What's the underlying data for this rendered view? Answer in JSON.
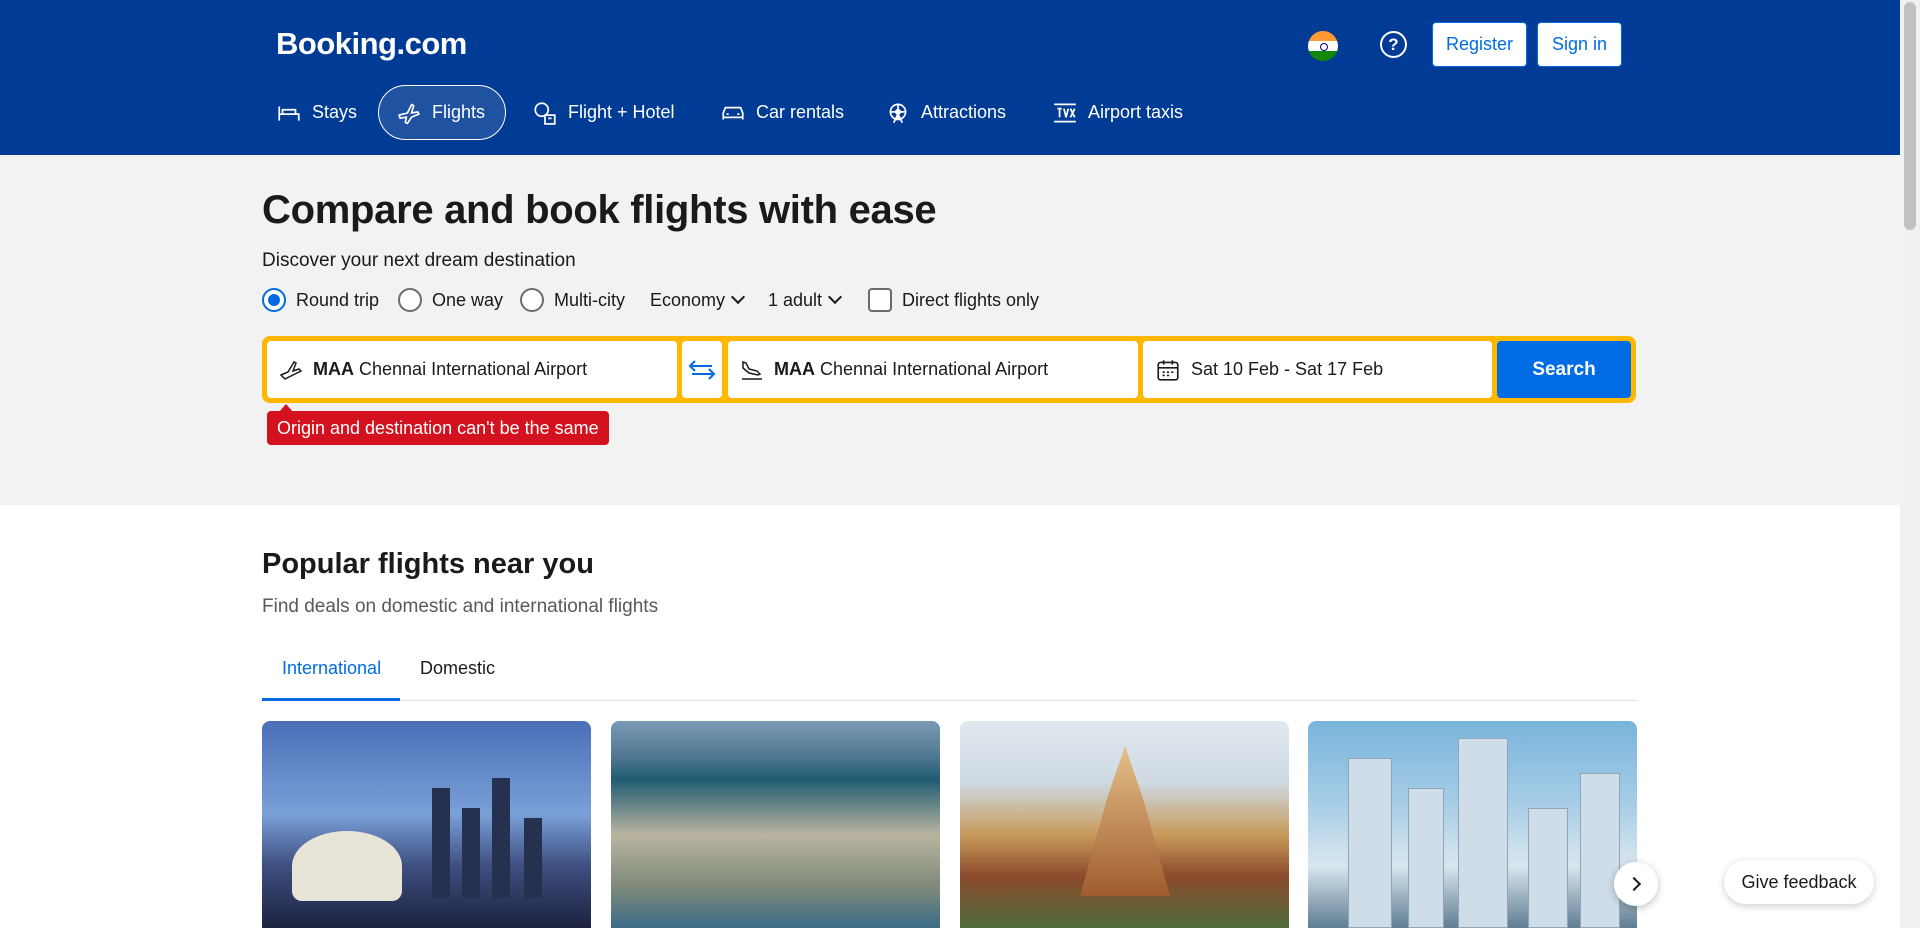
{
  "header": {
    "logo": "Booking.com",
    "register_label": "Register",
    "signin_label": "Sign in",
    "currency_flag": "india-flag-icon",
    "help_icon": "question-circle-icon"
  },
  "nav": {
    "items": [
      {
        "label": "Stays",
        "icon": "bed-icon"
      },
      {
        "label": "Flights",
        "icon": "plane-icon",
        "active": true
      },
      {
        "label": "Flight + Hotel",
        "icon": "plane-hotel-icon"
      },
      {
        "label": "Car rentals",
        "icon": "car-icon"
      },
      {
        "label": "Attractions",
        "icon": "ferris-wheel-icon"
      },
      {
        "label": "Airport taxis",
        "icon": "taxi-icon"
      }
    ]
  },
  "hero": {
    "title": "Compare and book flights with ease",
    "subtitle": "Discover your next dream destination",
    "trip_types": [
      "Round trip",
      "One way",
      "Multi-city"
    ],
    "selected_trip": "Round trip",
    "cabin_class": "Economy",
    "travellers": "1 adult",
    "direct_only_label": "Direct flights only",
    "direct_only_checked": false
  },
  "search": {
    "origin_code": "MAA",
    "origin_name": "Chennai International Airport",
    "destination_code": "MAA",
    "destination_name": "Chennai International Airport",
    "dates": "Sat 10 Feb - Sat 17 Feb",
    "button_label": "Search",
    "error": "Origin and destination can't be the same"
  },
  "popular": {
    "title": "Popular flights near you",
    "subtitle": "Find deals on domestic and international flights",
    "tabs": [
      "International",
      "Domestic"
    ],
    "active_tab": "International"
  },
  "feedback_label": "Give feedback",
  "colors": {
    "brand_blue": "#003b95",
    "accent_blue": "#006ce4",
    "search_border": "#ffb700",
    "error_red": "#d4111e"
  }
}
